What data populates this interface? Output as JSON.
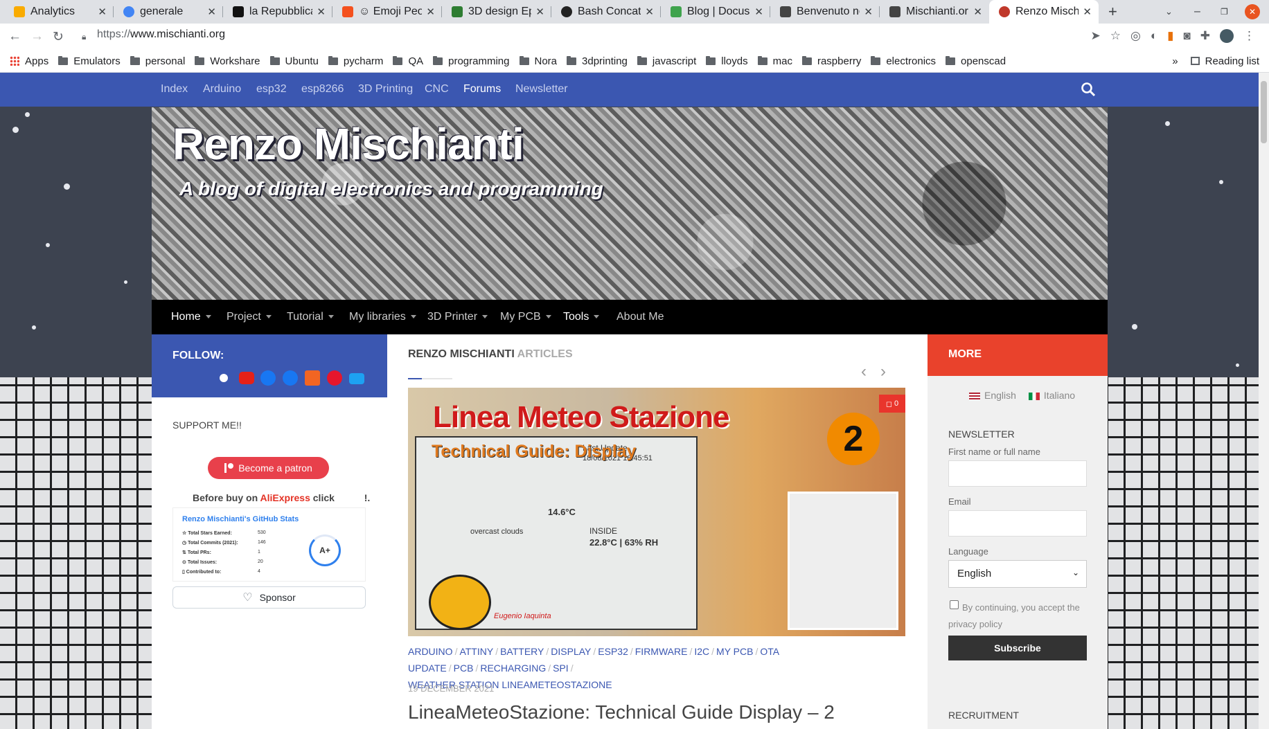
{
  "browser": {
    "tabs": [
      {
        "title": "Analytics",
        "color": "#f9ab00"
      },
      {
        "title": "generale",
        "color": "#4285f4"
      },
      {
        "title": "la Repubblica",
        "color": "#111111"
      },
      {
        "title": "☺ Emoji Peop",
        "color": "#f4511e"
      },
      {
        "title": "3D design Ep",
        "color": "#2e7d32"
      },
      {
        "title": "Bash Concate",
        "color": "#222222"
      },
      {
        "title": "Blog | Docusa",
        "color": "#3fa34d"
      },
      {
        "title": "Benvenuto ne",
        "color": "#444444"
      },
      {
        "title": "Mischianti.or",
        "color": "#444444"
      },
      {
        "title": "Renzo Mischi",
        "color": "#c0392b"
      }
    ],
    "url_scheme": "https://",
    "url_host": "www.mischianti.org",
    "bookmarks_apps": "Apps",
    "bookmarks": [
      "Emulators",
      "personal",
      "Workshare",
      "Ubuntu",
      "pycharm",
      "QA",
      "programming",
      "Nora",
      "3dprinting",
      "javascript",
      "lloyds",
      "mac",
      "raspberry",
      "electronics",
      "openscad"
    ],
    "bookmarks_more": "»",
    "reading_list": "Reading list"
  },
  "topnav": {
    "items": [
      "Index",
      "Arduino",
      "esp32",
      "esp8266",
      "3D Printing",
      "CNC",
      "Forums",
      "Newsletter"
    ]
  },
  "header": {
    "title": "Renzo Mischianti",
    "description": "A blog of digital electronics and programming"
  },
  "mainnav": {
    "items": [
      "Home",
      "Project",
      "Tutorial",
      "My libraries",
      "3D Printer",
      "My PCB",
      "Tools",
      "About Me"
    ]
  },
  "left": {
    "follow": "FOLLOW:",
    "support": "SUPPORT ME!!",
    "patron": "Become a patron",
    "before_buy_1": "Before buy on ",
    "aliexpress": "AliExpress",
    "before_buy_2": " click",
    "before_buy_3": "!.",
    "github": {
      "title": "Renzo Mischianti's GitHub Stats",
      "rows": [
        {
          "label": "Total Stars Earned:",
          "value": "530"
        },
        {
          "label": "Total Commits (2021):",
          "value": "146"
        },
        {
          "label": "Total PRs:",
          "value": "1"
        },
        {
          "label": "Total Issues:",
          "value": "20"
        },
        {
          "label": "Contributed to:",
          "value": "4"
        }
      ],
      "grade": "A+"
    },
    "sponsor": "Sponsor"
  },
  "main": {
    "title_1": "RENZO MISCHIANTI",
    "title_2": "ARTICLES",
    "featured": {
      "headline": "Linea Meteo Stazione",
      "subhead": "Technical Guide: Display",
      "number": "2",
      "comments": "0",
      "screen_text": [
        "Last Update",
        "18/08/2021 16:45:51",
        "14.6°C",
        "overcast clouds",
        "INSIDE",
        "22.8°C | 63% RH",
        "Eugenio Iaquinta"
      ]
    },
    "tags": [
      "ARDUINO",
      "ATTINY",
      "BATTERY",
      "DISPLAY",
      "ESP32",
      "FIRMWARE",
      "I2C",
      "MY PCB",
      "OTA UPDATE",
      "PCB",
      "RECHARGING",
      "SPI",
      "WEATHER STATION LINEAMETEOSTAZIONE"
    ],
    "date": "19 DECEMBER 2021",
    "post_title": "LineaMeteoStazione: Technical Guide Display – 2"
  },
  "right": {
    "more": "MORE",
    "lang_en": "English",
    "lang_it": "Italiano",
    "newsletter": "NEWSLETTER",
    "name_label": "First name or full name",
    "email_label": "Email",
    "language_label": "Language",
    "language_value": "English",
    "consent": "By continuing, you accept the privacy policy",
    "subscribe": "Subscribe",
    "recruitment": "RECRUITMENT"
  }
}
